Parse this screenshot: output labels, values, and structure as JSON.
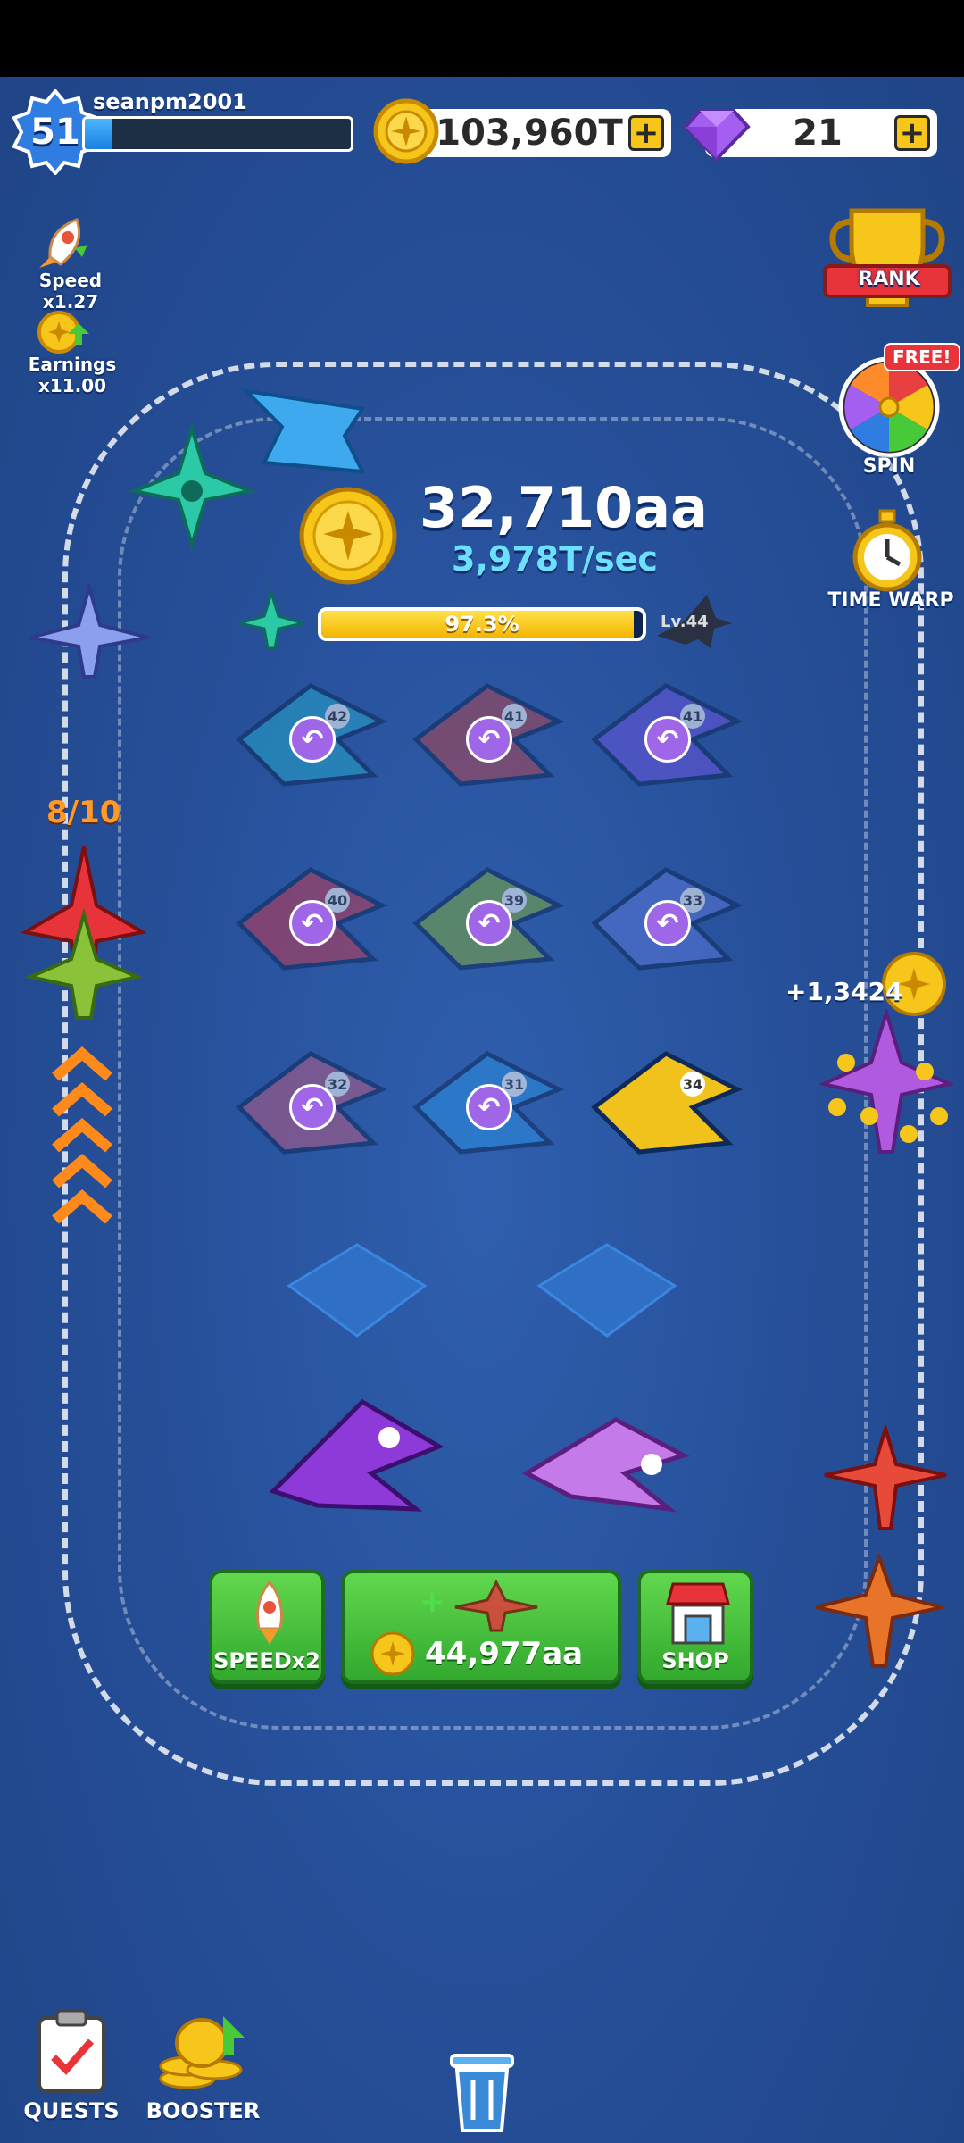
{
  "player": {
    "level": "51",
    "username": "seanpm2001",
    "xp_fraction": 0.1
  },
  "currency": {
    "coins": "103,960T",
    "gems": "21"
  },
  "boosts": {
    "speed_label": "Speed x1.27",
    "earnings_label": "Earnings x11.00"
  },
  "earnings": {
    "total": "32,710aa",
    "rate": "3,978T/sec"
  },
  "progress": {
    "percent_label": "97.3%",
    "fraction": 0.973,
    "next_level": "Lv.44"
  },
  "side_menu": {
    "rank": "RANK",
    "free_badge": "FREE!",
    "spin": "SPIN",
    "time_warp": "TIME WARP"
  },
  "stack": {
    "count": "8/10"
  },
  "floating_gain": "+1,3424",
  "actions": {
    "speed": "SPEEDx2",
    "buy_cost": "44,977aa",
    "shop": "SHOP"
  },
  "bottom_nav": {
    "quests": "QUESTS",
    "booster": "BOOSTER"
  },
  "grid_planes": [
    {
      "num": "42",
      "color": "#26a6c9",
      "ghost": true
    },
    {
      "num": "41",
      "color": "#b04450",
      "ghost": true
    },
    {
      "num": "41",
      "color": "#6a55e0",
      "ghost": true
    },
    {
      "num": "40",
      "color": "#c43a52",
      "ghost": true
    },
    {
      "num": "39",
      "color": "#7fa93c",
      "ghost": true
    },
    {
      "num": "33",
      "color": "#5a76d8",
      "ghost": true
    },
    {
      "num": "32",
      "color": "#b85a82",
      "ghost": true
    },
    {
      "num": "31",
      "color": "#2b8ee0",
      "ghost": true
    },
    {
      "num": "34",
      "color": "#f2c21c",
      "ghost": false
    }
  ],
  "colors": {
    "accent_green": "#3cbd36",
    "coin_gold": "#f6c61b",
    "gem_purple": "#a45ef0",
    "rate_cyan": "#6ee0ff"
  }
}
